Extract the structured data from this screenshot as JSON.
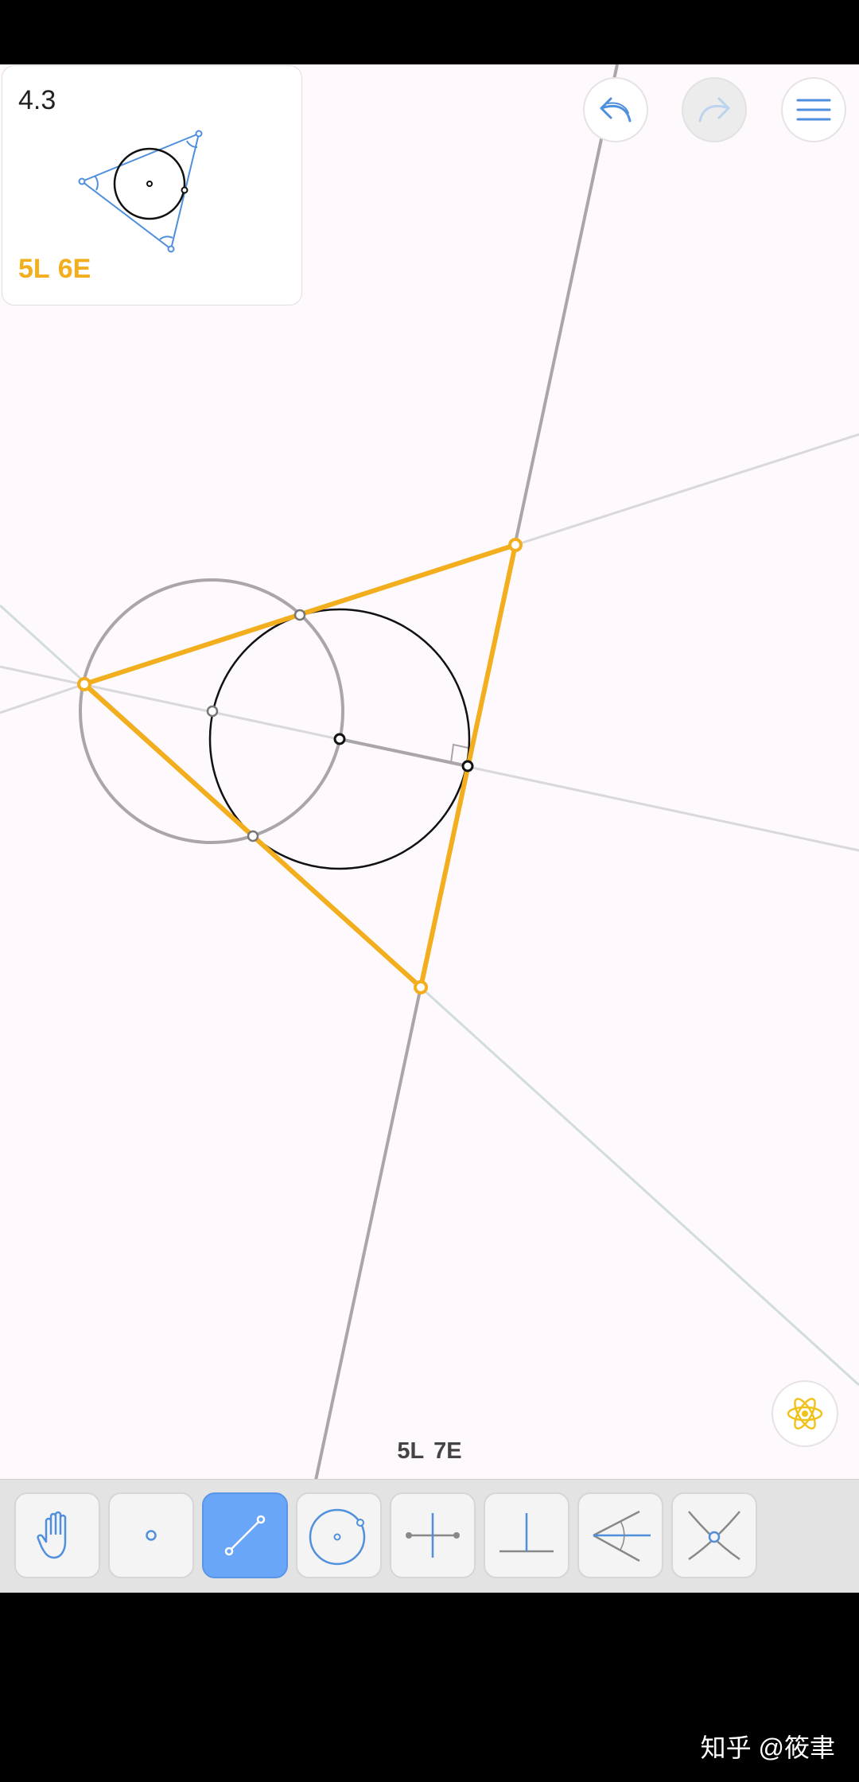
{
  "level": {
    "number": "4.3",
    "goal_L": "5L",
    "goal_E": "6E",
    "goal_color": "#f2ae1c"
  },
  "score": {
    "L": "5L",
    "E": "7E"
  },
  "header_buttons": [
    {
      "name": "undo-button",
      "icon": "undo-arrow-icon"
    },
    {
      "name": "redo-button",
      "icon": "redo-arrow-icon",
      "state": "disabled"
    },
    {
      "name": "menu-button",
      "icon": "hamburger-menu-icon"
    }
  ],
  "hint_button": {
    "icon": "atom-icon",
    "color": "#f2c21c"
  },
  "toolbar": {
    "tools": [
      {
        "name": "tool-move",
        "icon": "hand-icon"
      },
      {
        "name": "tool-point",
        "icon": "point-icon"
      },
      {
        "name": "tool-line",
        "icon": "line-icon",
        "active": true
      },
      {
        "name": "tool-circle",
        "icon": "circle-icon"
      },
      {
        "name": "tool-perpendicular-bisector",
        "icon": "perpendicular-bisector-icon"
      },
      {
        "name": "tool-perpendicular",
        "icon": "perpendicular-icon"
      },
      {
        "name": "tool-angle-bisector",
        "icon": "angle-bisector-icon"
      },
      {
        "name": "tool-intersection",
        "icon": "intersection-icon"
      }
    ],
    "accent_color": "#4f8fdc",
    "active_color": "#6aa6f8"
  },
  "colors": {
    "triangle": "#f2ae1c",
    "construction_gray": "#a9a5a8",
    "construction_light": "#dad8da",
    "incircle": "#000000",
    "canvas_bg": "#fdf9fc"
  },
  "watermark": "知乎 @筱聿"
}
